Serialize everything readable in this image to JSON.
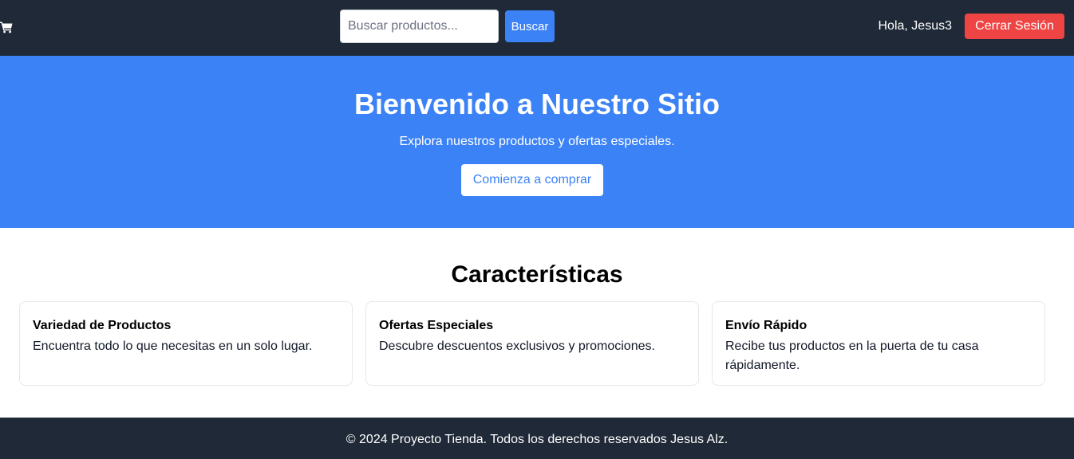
{
  "header": {
    "cart_icon": "shopping-cart-icon",
    "search": {
      "placeholder": "Buscar productos...",
      "value": "",
      "button_label": "Buscar"
    },
    "greeting": "Hola, Jesus3",
    "logout_label": "Cerrar Sesión"
  },
  "hero": {
    "title": "Bienvenido a Nuestro Sitio",
    "subtitle": "Explora nuestros productos y ofertas especiales.",
    "cta_label": "Comienza a comprar"
  },
  "features": {
    "heading": "Características",
    "cards": [
      {
        "title": "Variedad de Productos",
        "description": "Encuentra todo lo que necesitas en un solo lugar."
      },
      {
        "title": "Ofertas Especiales",
        "description": "Descubre descuentos exclusivos y promociones."
      },
      {
        "title": "Envío Rápido",
        "description": "Recibe tus productos en la puerta de tu casa rápidamente."
      }
    ]
  },
  "footer": {
    "text": "© 2024 Proyecto Tienda. Todos los derechos reservados Jesus Alz."
  },
  "colors": {
    "navbar_bg": "#1f2937",
    "hero_bg": "#3b82f6",
    "primary": "#3b82f6",
    "danger": "#ef4444",
    "footer_bg": "#1f2937"
  }
}
